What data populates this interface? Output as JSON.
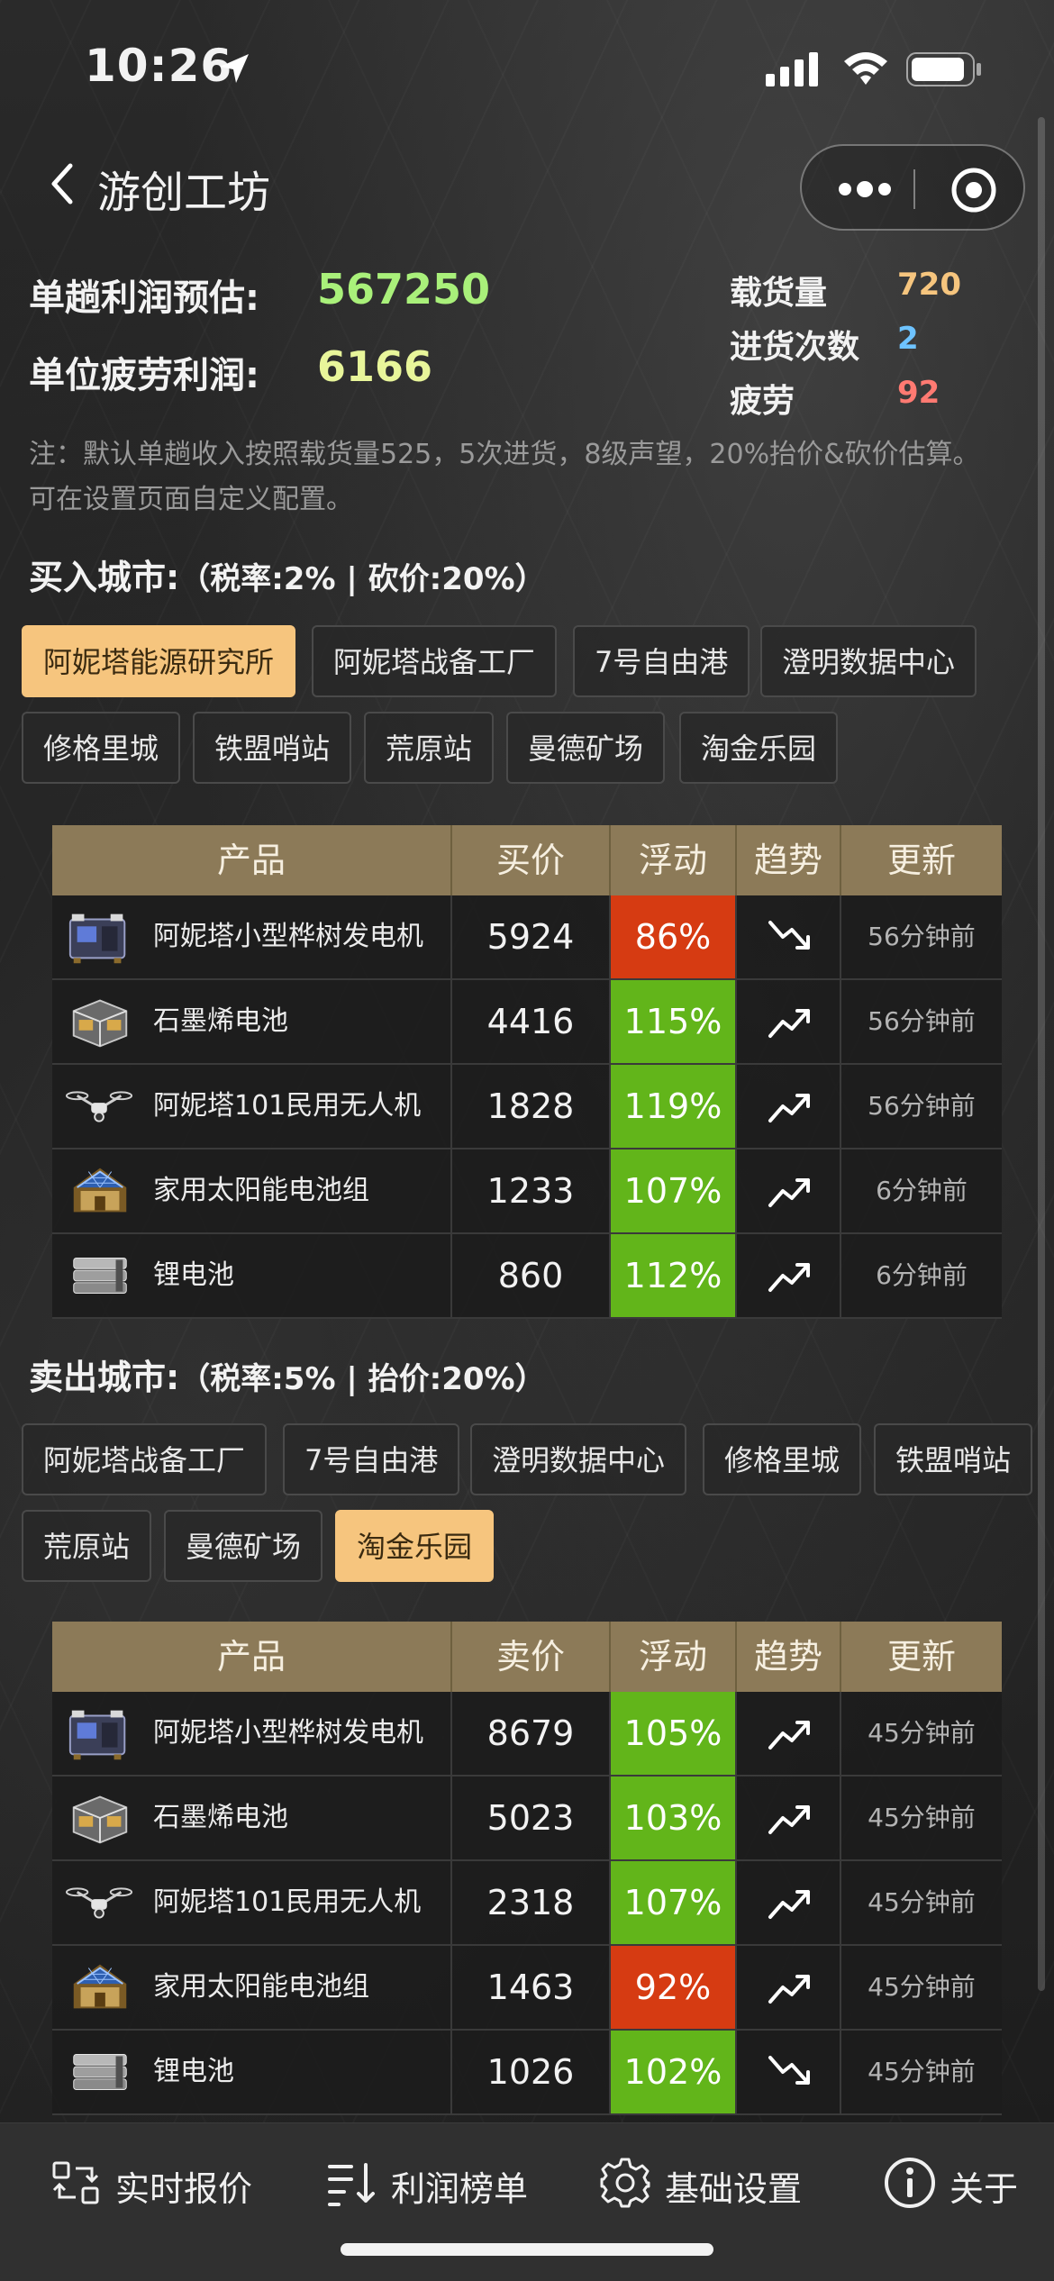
{
  "status_bar": {
    "time": "10:26"
  },
  "nav": {
    "title": "游创工坊"
  },
  "summary": {
    "trip_profit_label": "单趟利润预估:",
    "trip_profit_value": "567250",
    "unit_profit_label": "单位疲劳利润:",
    "unit_profit_value": "6166",
    "capacity_label": "载货量",
    "capacity_value": "720",
    "restock_label": "进货次数",
    "restock_value": "2",
    "fatigue_label": "疲劳",
    "fatigue_value": "92",
    "note_line1": "注：默认单趟收入按照载货量525，5次进货，8级声望，20%抬价&砍价估算。",
    "note_line2": "可在设置页面自定义配置。",
    "colors": {
      "trip_profit": "#a9f07a",
      "unit_profit": "#e8f59a",
      "capacity": "#f6c57e",
      "restock": "#6ec3ff",
      "fatigue": "#ff7a72"
    }
  },
  "buy": {
    "title": "买入城市:",
    "subtitle": "（税率:2% | 砍价:20%）",
    "cities": [
      "阿妮塔能源研究所",
      "阿妮塔战备工厂",
      "7号自由港",
      "澄明数据中心",
      "修格里城",
      "铁盟哨站",
      "荒原站",
      "曼德矿场",
      "淘金乐园"
    ],
    "selected_city": "阿妮塔能源研究所",
    "headers": [
      "产品",
      "买价",
      "浮动",
      "趋势",
      "更新"
    ],
    "rows": [
      {
        "name": "阿妮塔小型桦树发电机",
        "price": "5924",
        "float": "86%",
        "float_dir": "down",
        "trend": "down",
        "updated": "56分钟前",
        "icon": "generator-icon"
      },
      {
        "name": "石墨烯电池",
        "price": "4416",
        "float": "115%",
        "float_dir": "up",
        "trend": "up",
        "updated": "56分钟前",
        "icon": "graphene-battery-icon"
      },
      {
        "name": "阿妮塔101民用无人机",
        "price": "1828",
        "float": "119%",
        "float_dir": "up",
        "trend": "up",
        "updated": "56分钟前",
        "icon": "drone-icon"
      },
      {
        "name": "家用太阳能电池组",
        "price": "1233",
        "float": "107%",
        "float_dir": "up",
        "trend": "up",
        "updated": "6分钟前",
        "icon": "solar-panel-icon"
      },
      {
        "name": "锂电池",
        "price": "860",
        "float": "112%",
        "float_dir": "up",
        "trend": "up",
        "updated": "6分钟前",
        "icon": "lithium-battery-icon"
      }
    ]
  },
  "sell": {
    "title": "卖出城市:",
    "subtitle": "（税率:5% | 抬价:20%）",
    "cities": [
      "阿妮塔战备工厂",
      "7号自由港",
      "澄明数据中心",
      "修格里城",
      "铁盟哨站",
      "荒原站",
      "曼德矿场",
      "淘金乐园"
    ],
    "selected_city": "淘金乐园",
    "headers": [
      "产品",
      "卖价",
      "浮动",
      "趋势",
      "更新"
    ],
    "rows": [
      {
        "name": "阿妮塔小型桦树发电机",
        "price": "8679",
        "float": "105%",
        "float_dir": "up",
        "trend": "up",
        "updated": "45分钟前",
        "icon": "generator-icon"
      },
      {
        "name": "石墨烯电池",
        "price": "5023",
        "float": "103%",
        "float_dir": "up",
        "trend": "up",
        "updated": "45分钟前",
        "icon": "graphene-battery-icon"
      },
      {
        "name": "阿妮塔101民用无人机",
        "price": "2318",
        "float": "107%",
        "float_dir": "up",
        "trend": "up",
        "updated": "45分钟前",
        "icon": "drone-icon"
      },
      {
        "name": "家用太阳能电池组",
        "price": "1463",
        "float": "92%",
        "float_dir": "down",
        "trend": "up",
        "updated": "45分钟前",
        "icon": "solar-panel-icon"
      },
      {
        "name": "锂电池",
        "price": "1026",
        "float": "102%",
        "float_dir": "up",
        "trend": "down",
        "updated": "45分钟前",
        "icon": "lithium-battery-icon"
      }
    ]
  },
  "tabbar": {
    "items": [
      {
        "label": "实时报价",
        "icon": "exchange-icon"
      },
      {
        "label": "利润榜单",
        "icon": "ranking-icon"
      },
      {
        "label": "基础设置",
        "icon": "gear-icon"
      },
      {
        "label": "关于",
        "icon": "info-icon"
      }
    ]
  }
}
